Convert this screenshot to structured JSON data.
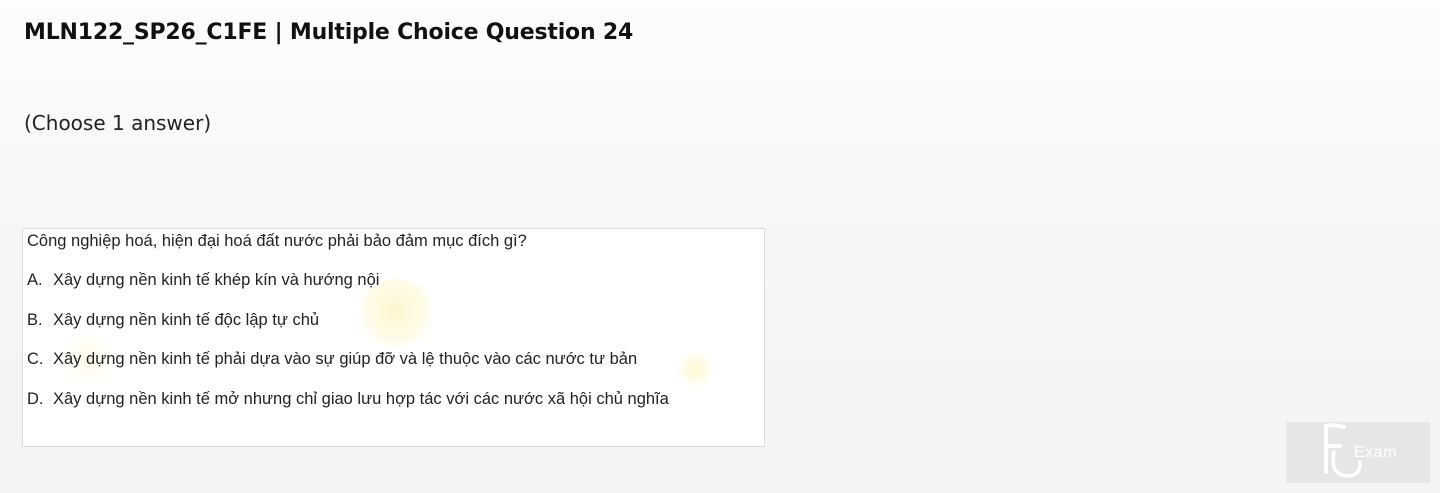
{
  "page": {
    "title": "MLN122_SP26_C1FE | Multiple Choice Question 24",
    "instruction": "(Choose 1 answer)"
  },
  "question": {
    "text": "Công nghiệp hoá, hiện đại hoá đất nước phải bảo đảm mục đích gì?",
    "answers": [
      {
        "letter": "A.",
        "text": "Xây dựng nền kinh tế khép kín và hướng nội"
      },
      {
        "letter": "B.",
        "text": "Xây dựng nền kinh tế độc lập tự chủ"
      },
      {
        "letter": "C.",
        "text": "Xây dựng nền kinh tế phải dựa vào sự giúp đỡ và lệ thuộc vào các nước tư bản"
      },
      {
        "letter": "D.",
        "text": "Xây dựng nền kinh tế mở nhưng chỉ giao lưu hợp tác với các nước xã hội chủ nghĩa"
      }
    ]
  },
  "logo": {
    "text": "Exam",
    "icon": "fu-exam-logo-icon"
  },
  "colors": {
    "background": "#f3f4f6",
    "card_background": "#ffffff",
    "card_border": "#dcdcdc",
    "text": "#222222",
    "logo_background": "#e6e6e7"
  }
}
